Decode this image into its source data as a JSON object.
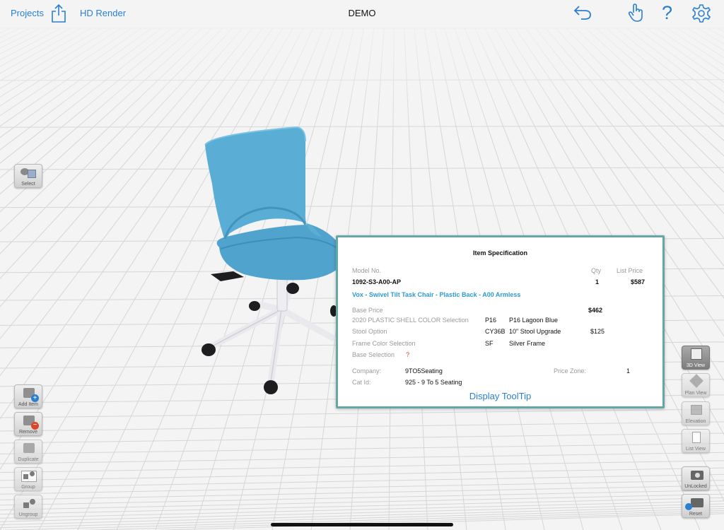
{
  "header": {
    "projects_label": "Projects",
    "hd_render_label": "HD Render",
    "title": "DEMO"
  },
  "left_toolbar": {
    "select_label": "Select",
    "add_item_label": "Add Item",
    "remove_label": "Remove",
    "duplicate_label": "Duplicate",
    "group_label": "Group",
    "ungroup_label": "Ungroup"
  },
  "right_toolbar": {
    "view_3d_label": "3D View",
    "plan_view_label": "Plan View",
    "elevation_label": "Elevation",
    "list_view_label": "List View",
    "unlocked_label": "UnLocked",
    "reset_label": "Reset"
  },
  "item_spec": {
    "title": "Item Specification",
    "model_header": "Model No.",
    "qty_header": "Qty",
    "list_price_header": "List Price",
    "model_no": "1092-S3-A00-AP",
    "qty": "1",
    "list_price": "$587",
    "description": "Vox - Swivel Tilt Task Chair - Plastic Back - A00 Armless",
    "base_price_label": "Base Price",
    "base_price": "$462",
    "options": [
      {
        "label": "2020 PLASTIC SHELL COLOR Selection",
        "code": "P16",
        "desc": "P16 Lagoon Blue",
        "price": ""
      },
      {
        "label": "Stool Option",
        "code": "CY36B",
        "desc": "10\" Stool Upgrade",
        "price": "$125"
      },
      {
        "label": "Frame Color Selection",
        "code": "SF",
        "desc": "Silver Frame",
        "price": ""
      }
    ],
    "base_selection_label": "Base Selection",
    "base_selection_mark": "?",
    "company_label": "Company:",
    "company_value": "9TO5Seating",
    "price_zone_label": "Price Zone:",
    "price_zone_value": "1",
    "cat_id_label": "Cat Id:",
    "cat_id_value": "925 - 9 To 5 Seating",
    "tooltip_link": "Display ToolTip"
  },
  "colors": {
    "accent": "#2a7fd4",
    "panel_border": "#64a7a5",
    "chair_shell": "#4fa3cc",
    "description_blue": "#2e9bd0"
  }
}
